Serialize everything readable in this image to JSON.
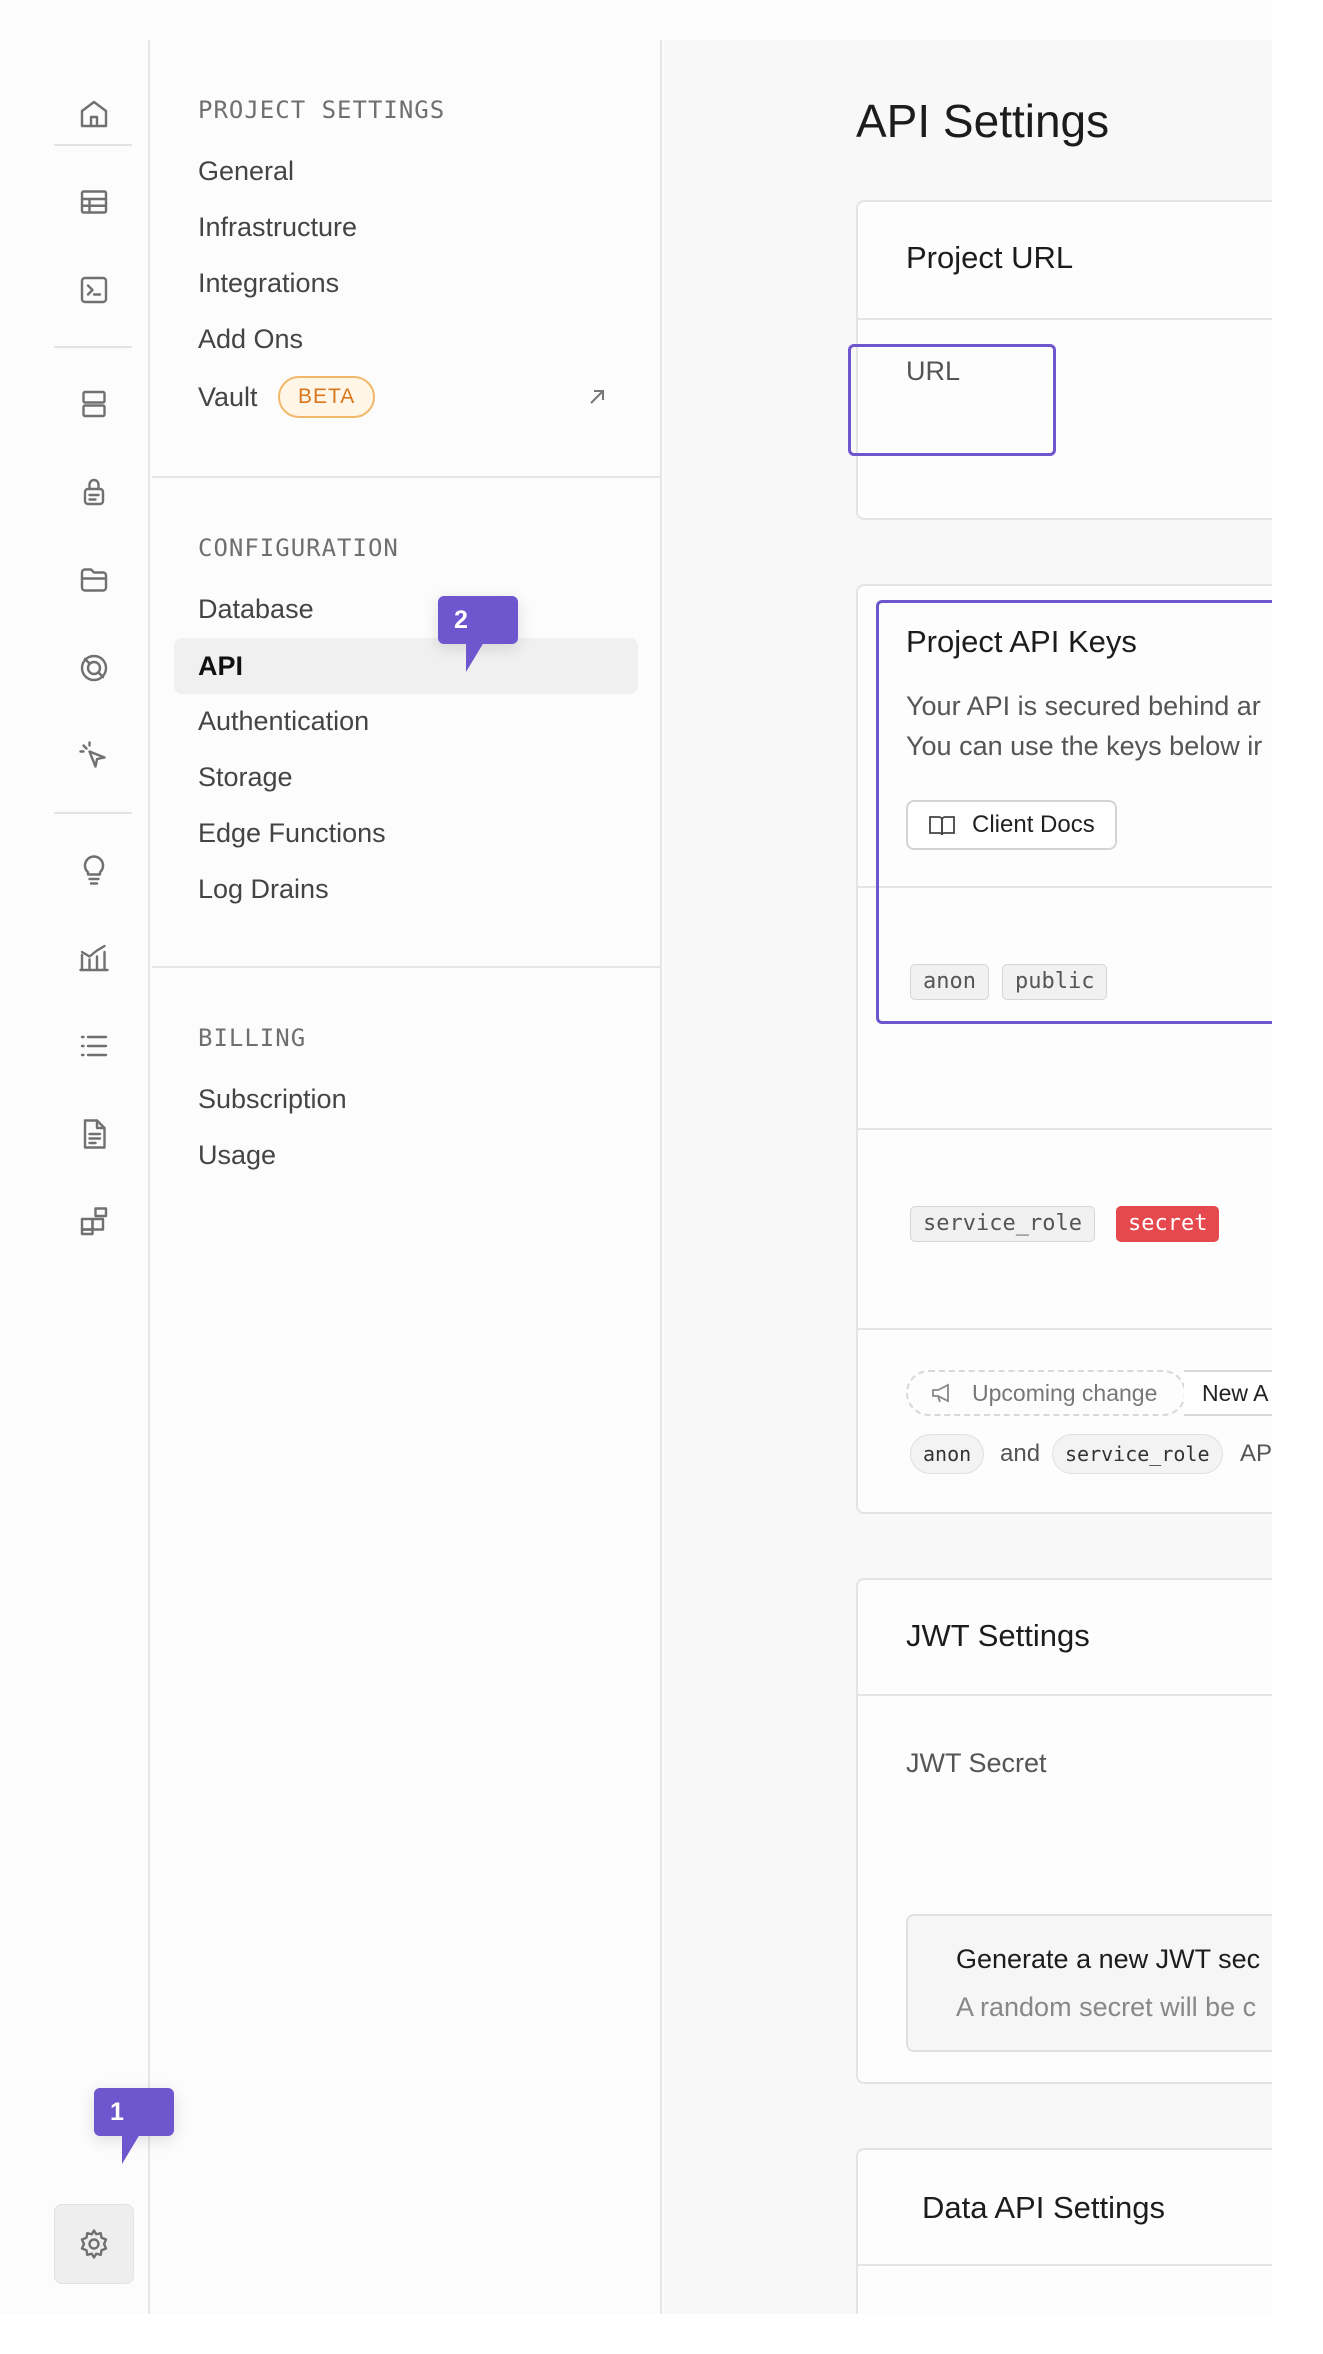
{
  "rail": {
    "icons": [
      "home-icon",
      "table-editor-icon",
      "sql-editor-icon",
      "database-icon",
      "auth-icon",
      "storage-icon",
      "realtime-icon",
      "edge-functions-icon",
      "advisors-icon",
      "reports-icon",
      "logs-icon",
      "api-docs-icon",
      "integrations-icon",
      "settings-icon"
    ]
  },
  "menu": {
    "project_settings": {
      "heading": "PROJECT SETTINGS",
      "items": [
        "General",
        "Infrastructure",
        "Integrations",
        "Add Ons",
        "Vault"
      ],
      "beta_badge": "BETA"
    },
    "configuration": {
      "heading": "CONFIGURATION",
      "items": [
        "Database",
        "API",
        "Authentication",
        "Storage",
        "Edge Functions",
        "Log Drains"
      ],
      "active": "API"
    },
    "billing": {
      "heading": "BILLING",
      "items": [
        "Subscription",
        "Usage"
      ]
    }
  },
  "main": {
    "title": "API Settings",
    "project_url": {
      "title": "Project URL",
      "url_label": "URL"
    },
    "api_keys": {
      "title": "Project API Keys",
      "desc_line1": "Your API is secured behind ar",
      "desc_line2": "You can use the keys below ir",
      "docs_button": "Client Docs",
      "anon_pill": "anon",
      "public_pill": "public",
      "service_role_pill": "service_role",
      "secret_pill": "secret",
      "upcoming_label": "Upcoming change",
      "new_chip": "New A",
      "notice_anon": "anon",
      "notice_and": "and",
      "notice_service_role": "service_role",
      "notice_tail": "AP"
    },
    "jwt": {
      "title": "JWT Settings",
      "secret_label": "JWT Secret",
      "generate_title": "Generate a new JWT sec",
      "generate_desc": "A random secret will be c"
    },
    "data_api": {
      "title": "Data API Settings"
    }
  },
  "tooltips": {
    "step1": "1",
    "step2": "2"
  },
  "colors": {
    "accent": "#6e56cf",
    "secret": "#e5484d",
    "beta": "#d9771c"
  }
}
